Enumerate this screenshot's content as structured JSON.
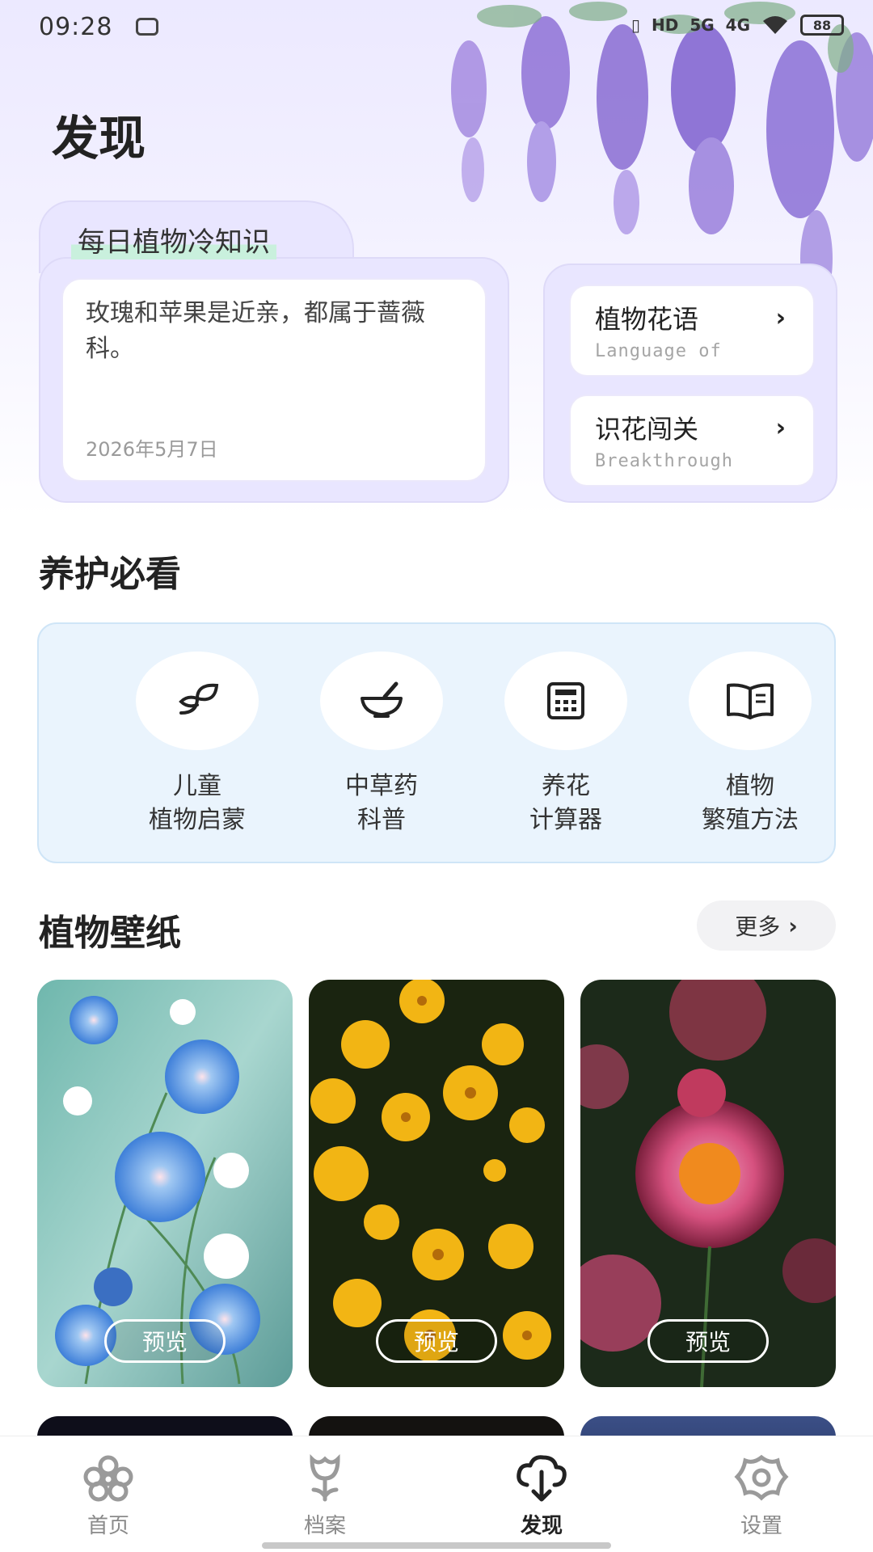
{
  "status_bar": {
    "time": "09:28",
    "hd": "HD",
    "sim1": "5G",
    "sim2": "4G",
    "battery": "88"
  },
  "page": {
    "title": "发现"
  },
  "trivia": {
    "heading": "每日植物冷知识",
    "text": "玫瑰和苹果是近亲，都属于蔷薇科。",
    "date": "2026年5月7日"
  },
  "side_links": [
    {
      "title": "植物花语",
      "subtitle": "Language of"
    },
    {
      "title": "识花闯关",
      "subtitle": "Breakthrough"
    }
  ],
  "care": {
    "title": "养护必看",
    "items": [
      {
        "label": "儿童\n植物启蒙",
        "icon": "sprout-icon"
      },
      {
        "label": "中草药\n科普",
        "icon": "mortar-pestle-icon"
      },
      {
        "label": "养花\n计算器",
        "icon": "calculator-icon"
      },
      {
        "label": "植物\n繁殖方法",
        "icon": "open-book-icon"
      }
    ]
  },
  "wallpapers": {
    "title": "植物壁纸",
    "more_label": "更多",
    "preview_label": "预览"
  },
  "bottom_nav": [
    {
      "label": "首页",
      "icon": "flower-icon",
      "active": false
    },
    {
      "label": "档案",
      "icon": "tulip-icon",
      "active": false
    },
    {
      "label": "发现",
      "icon": "tree-download-icon",
      "active": true
    },
    {
      "label": "设置",
      "icon": "gear-flower-icon",
      "active": false
    }
  ],
  "colors": {
    "accent_lavender": "#e9e6ff",
    "care_panel_bg": "#eaf4fd",
    "highlight_green": "#c9f0dd"
  }
}
